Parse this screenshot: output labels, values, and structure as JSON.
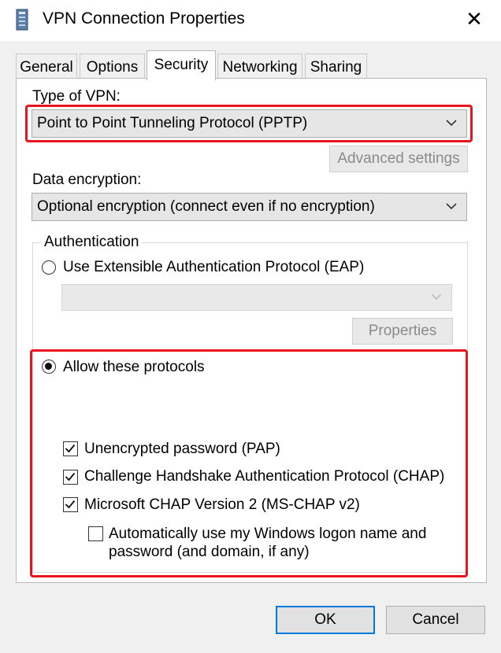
{
  "window": {
    "title": "VPN Connection Properties",
    "close_symbol": "✕"
  },
  "tabs": [
    {
      "label": "General"
    },
    {
      "label": "Options"
    },
    {
      "label": "Security"
    },
    {
      "label": "Networking"
    },
    {
      "label": "Sharing"
    }
  ],
  "security": {
    "type_label": "Type of VPN:",
    "type_value": "Point to Point Tunneling Protocol (PPTP)",
    "advanced_button": "Advanced settings",
    "encryption_label": "Data encryption:",
    "encryption_value": "Optional encryption (connect even if no encryption)",
    "authentication": {
      "group_label": "Authentication",
      "eap_label": "Use Extensible Authentication Protocol (EAP)",
      "eap_selected": false,
      "eap_dropdown_value": "",
      "properties_button": "Properties",
      "allow_label": "Allow these protocols",
      "allow_selected": true,
      "protocols": [
        {
          "label": "Unencrypted password (PAP)",
          "checked": true
        },
        {
          "label": "Challenge Handshake Authentication Protocol (CHAP)",
          "checked": true
        },
        {
          "label": "Microsoft CHAP Version 2 (MS-CHAP v2)",
          "checked": true
        }
      ],
      "auto_logon_line1": "Automatically use my Windows logon name and",
      "auto_logon_line2": "password (and domain, if any)",
      "auto_logon_checked": false
    }
  },
  "footer": {
    "ok_label": "OK",
    "cancel_label": "Cancel"
  },
  "colors": {
    "highlight_border": "#e8141e",
    "focus_border": "#0078d7",
    "panel_bg": "#ffffff",
    "dialog_bg": "#f0f0f0"
  },
  "icons": [
    "vpn-app-icon",
    "close-icon",
    "chevron-down-icon",
    "radio-icon",
    "checkbox-icon",
    "checkmark-icon"
  ]
}
